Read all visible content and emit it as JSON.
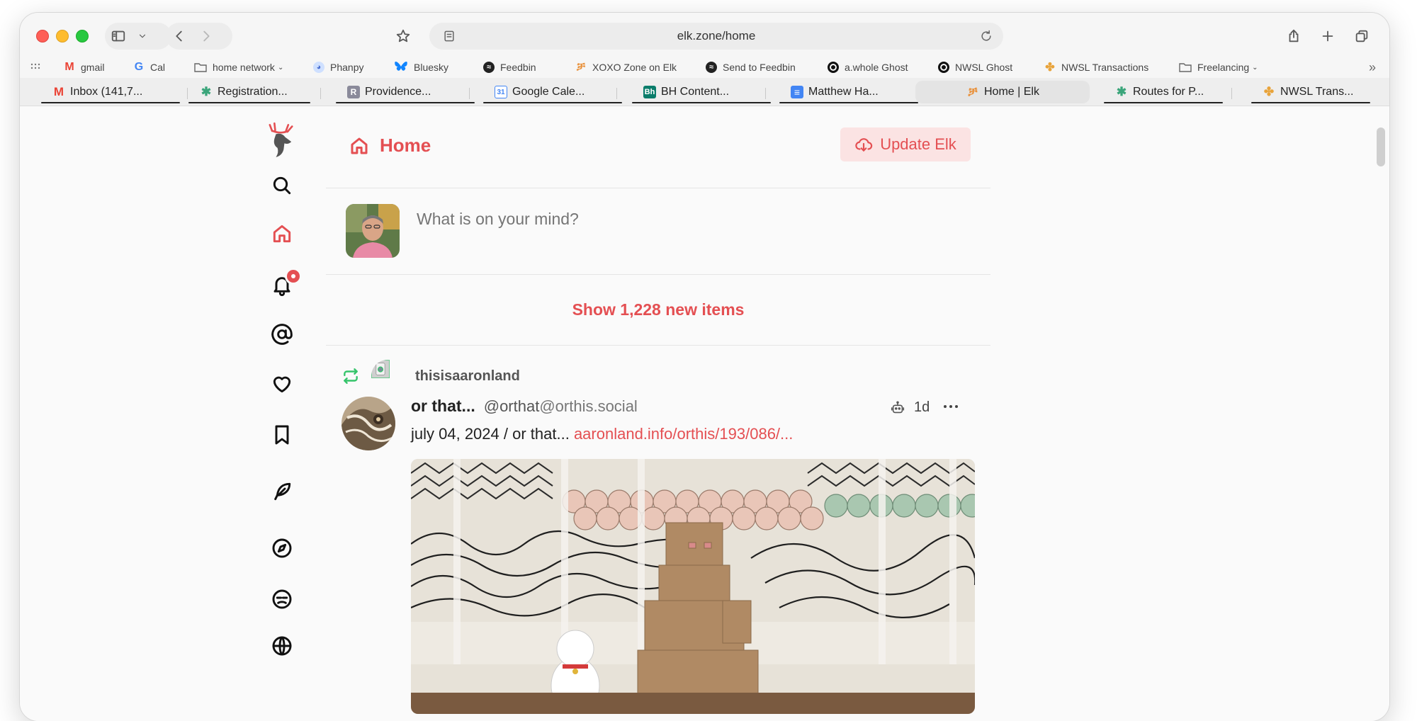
{
  "browser": {
    "url": "elk.zone/home",
    "bookmarks": [
      {
        "label": "gmail",
        "icon": "gmail-icon",
        "color": "#ea4335"
      },
      {
        "label": "Cal",
        "icon": "google-icon",
        "color": "#4285f4"
      },
      {
        "label": "home network",
        "icon": "folder-icon",
        "color": "#666666",
        "dropdown": true
      },
      {
        "label": "Phanpy",
        "icon": "phanpy-icon",
        "color": "#6b8fe6"
      },
      {
        "label": "Bluesky",
        "icon": "butterfly-icon",
        "color": "#1185fe"
      },
      {
        "label": "Feedbin",
        "icon": "feedbin-icon",
        "color": "#222222"
      },
      {
        "label": "XOXO Zone on Elk",
        "icon": "elk-icon",
        "color": "#e9913b"
      },
      {
        "label": "Send to Feedbin",
        "icon": "feedbin-icon",
        "color": "#222222"
      },
      {
        "label": "a.whole Ghost",
        "icon": "ghost-icon",
        "color": "#111111"
      },
      {
        "label": "NWSL Ghost",
        "icon": "ghost-icon",
        "color": "#111111"
      },
      {
        "label": "NWSL Transactions",
        "icon": "pinwheel-icon",
        "color": "#e8a33a"
      },
      {
        "label": "Freelancing",
        "icon": "folder-icon",
        "color": "#666666",
        "dropdown": true
      }
    ],
    "tabs": [
      {
        "label": "Inbox (141,7...",
        "icon": "gmail-icon",
        "icon_text": "M",
        "color": "#ea4335"
      },
      {
        "label": "Registration...",
        "icon": "slack-icon",
        "icon_text": "✱",
        "color": "#3aa57a"
      },
      {
        "label": "Providence...",
        "icon": "r-icon",
        "icon_text": "R",
        "color": "#8a8a9a"
      },
      {
        "label": "Google Cale...",
        "icon": "calendar-icon",
        "icon_text": "31",
        "color": "#4285f4"
      },
      {
        "label": "BH Content...",
        "icon": "behance-icon",
        "icon_text": "Bh",
        "color": "#0b7d6b"
      },
      {
        "label": "Matthew Ha...",
        "icon": "docs-icon",
        "icon_text": "≡",
        "color": "#4285f4"
      },
      {
        "label": "Home | Elk",
        "icon": "elk-icon",
        "icon_text": "⌘",
        "color": "#e9913b",
        "active": true
      },
      {
        "label": "Routes for P...",
        "icon": "slack-icon",
        "icon_text": "✱",
        "color": "#3aa57a"
      },
      {
        "label": "NWSL Trans...",
        "icon": "pinwheel-icon",
        "icon_text": "✦",
        "color": "#e8a33a"
      }
    ]
  },
  "header": {
    "title": "Home",
    "update_label": "Update Elk"
  },
  "composer": {
    "placeholder": "What is on your mind?"
  },
  "feed": {
    "show_new_label": "Show 1,228 new items"
  },
  "post": {
    "reblogged_by": "thisisaaronland",
    "author_name": "or that...",
    "author_handle": "@orthat",
    "author_domain": "@orthis.social",
    "age": "1d",
    "text": "july 04, 2024 / or that...",
    "link": "aaronland.info/orthis/193/086/..."
  },
  "colors": {
    "accent": "#e44f52",
    "reblog": "#35c46a"
  }
}
